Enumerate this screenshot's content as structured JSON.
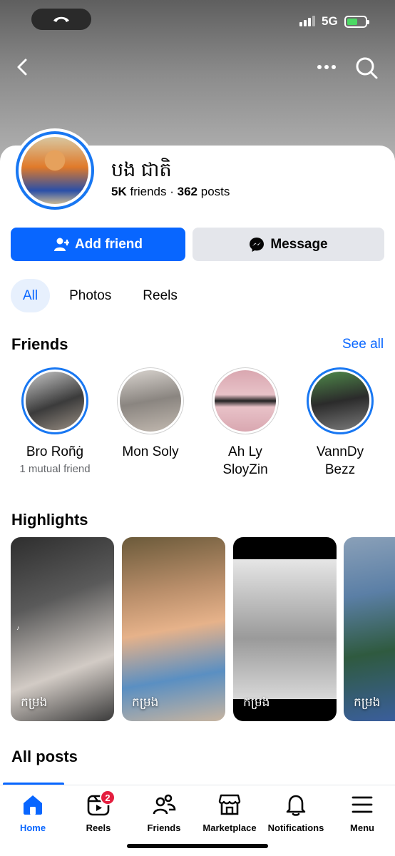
{
  "status_bar": {
    "network": "5G"
  },
  "profile": {
    "name": "បង ជាតិ",
    "friends_count": "5K",
    "friends_word": "friends",
    "separator": "·",
    "posts_count": "362",
    "posts_word": "posts"
  },
  "actions": {
    "add_friend": "Add friend",
    "message": "Message"
  },
  "tabs": [
    {
      "label": "All",
      "active": true
    },
    {
      "label": "Photos",
      "active": false
    },
    {
      "label": "Reels",
      "active": false
    }
  ],
  "friends_section": {
    "title": "Friends",
    "see_all": "See all",
    "items": [
      {
        "name": "Bro Roñġ",
        "mutual": "1 mutual friend",
        "story": true
      },
      {
        "name": "Mon Soly",
        "mutual": "",
        "story": false
      },
      {
        "name": "Ah Ly SloyZin",
        "mutual": "",
        "story": false
      },
      {
        "name": "VannDy Bezz",
        "mutual": "",
        "story": true
      }
    ]
  },
  "highlights": {
    "title": "Highlights",
    "items": [
      {
        "label": "កម្រង",
        "colors": [
          "#3a3a3a",
          "#c9c2bd",
          "#5a5a5a"
        ]
      },
      {
        "label": "កម្រង",
        "colors": [
          "#6b5a3a",
          "#e3a36e",
          "#4f8fc9"
        ]
      },
      {
        "label": "កម្រង",
        "colors": [
          "#111111",
          "#d8d8d8",
          "#777777"
        ]
      },
      {
        "label": "កម្រង",
        "colors": [
          "#5b7fa6",
          "#2f6b4a",
          "#3c5fa8"
        ]
      }
    ]
  },
  "all_posts": {
    "title": "All posts"
  },
  "nav": {
    "items": [
      {
        "label": "Home",
        "icon": "home-icon",
        "active": true
      },
      {
        "label": "Reels",
        "icon": "reels-icon",
        "badge": "2"
      },
      {
        "label": "Friends",
        "icon": "friends-icon"
      },
      {
        "label": "Marketplace",
        "icon": "marketplace-icon"
      },
      {
        "label": "Notifications",
        "icon": "bell-icon"
      },
      {
        "label": "Menu",
        "icon": "menu-icon"
      }
    ]
  },
  "colors": {
    "brand": "#0866ff",
    "badge": "#e41e3f",
    "story_ring": "#1877f2"
  }
}
